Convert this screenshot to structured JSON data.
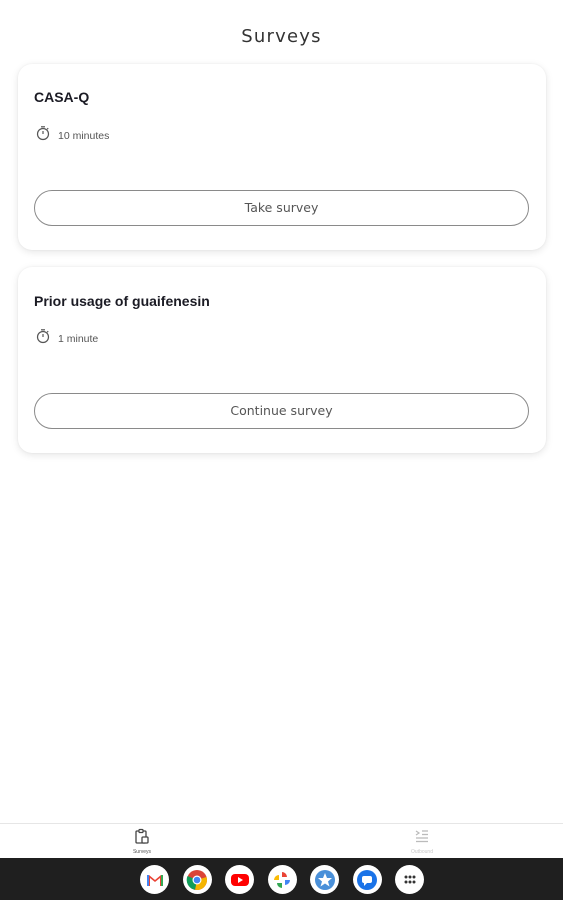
{
  "header": {
    "title": "Surveys"
  },
  "surveys": [
    {
      "title": "CASA-Q",
      "duration": "10 minutes",
      "action": "Take survey"
    },
    {
      "title": "Prior usage of guaifenesin",
      "duration": "1 minute",
      "action": "Continue survey"
    }
  ],
  "bottom_nav": {
    "items": [
      {
        "label": "Surveys",
        "icon": "surveys-icon",
        "active": true
      },
      {
        "label": "Outbound",
        "icon": "outbound-icon",
        "active": false
      }
    ]
  },
  "dock": {
    "apps": [
      "gmail-icon",
      "chrome-icon",
      "youtube-icon",
      "photos-icon",
      "star-app-icon",
      "messages-icon",
      "app-drawer-icon"
    ]
  },
  "colors": {
    "text_primary": "#1b1b24",
    "button_border": "#8a8a8a",
    "system_bar": "#1f1f1f"
  }
}
